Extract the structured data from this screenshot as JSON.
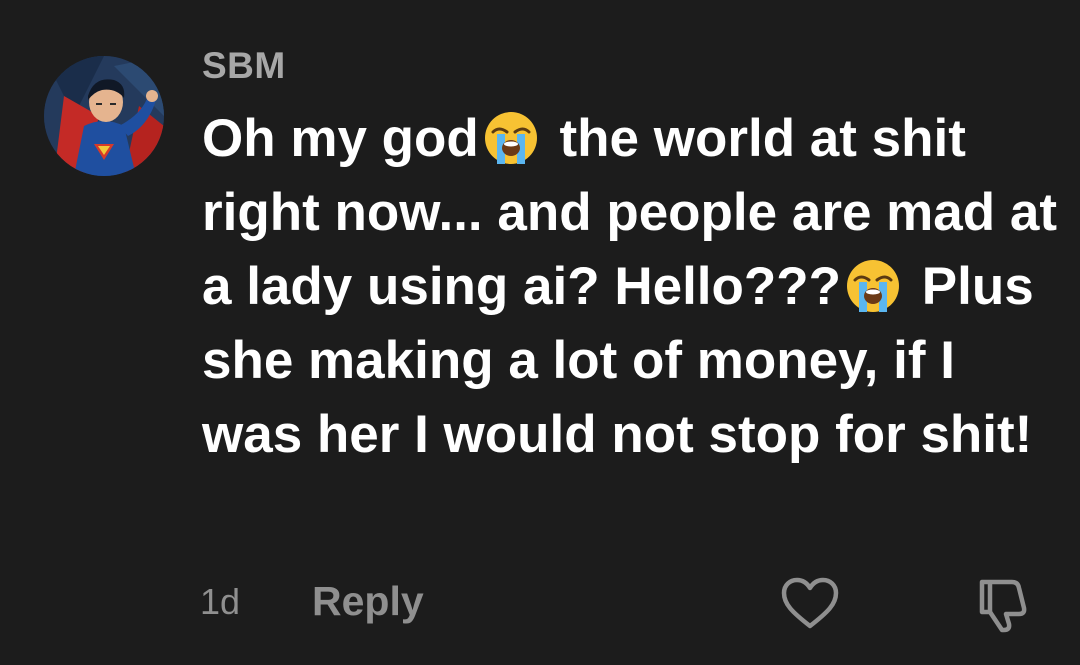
{
  "comment": {
    "username": "SBM",
    "text_parts": {
      "p1": "Oh my god",
      "p2": "the world at shit right now... and people are mad at a lady using ai? Hello???",
      "p3": "Plus she making a lot of money, if I was her I would not stop for shit!"
    },
    "emoji_name": "loudly-crying-face-emoji",
    "age": "1d",
    "reply_label": "Reply",
    "icons": {
      "like": "heart-icon",
      "dislike": "thumbs-down-icon",
      "avatar": "superhero-avatar"
    },
    "colors": {
      "background": "#1c1c1c",
      "text": "#ffffff",
      "muted": "#8f8f8f",
      "username": "#a7a7a7"
    }
  }
}
